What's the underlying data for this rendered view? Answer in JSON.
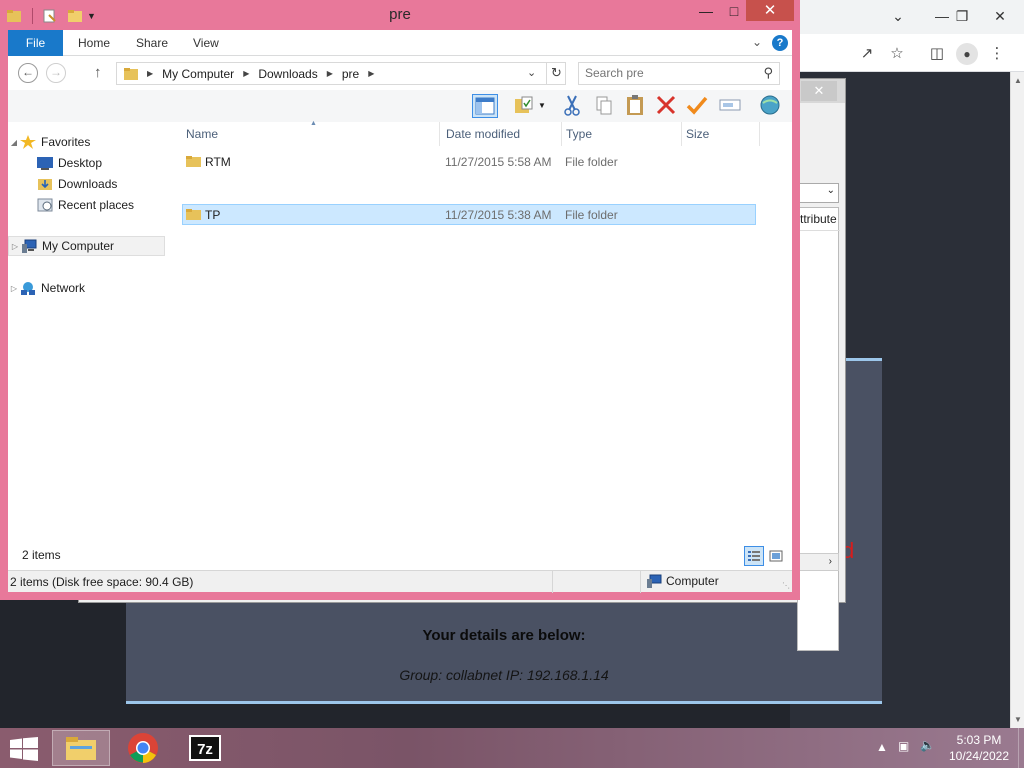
{
  "explorer": {
    "title": "pre",
    "ribbon_tabs": [
      "File",
      "Home",
      "Share",
      "View"
    ],
    "help": "?",
    "breadcrumb": [
      "My Computer",
      "Downloads",
      "pre"
    ],
    "search_placeholder": "Search pre",
    "nav": {
      "favorites": "Favorites",
      "desktop": "Desktop",
      "downloads": "Downloads",
      "recent": "Recent places",
      "my_computer": "My Computer",
      "network": "Network"
    },
    "columns": {
      "name": "Name",
      "date": "Date modified",
      "type": "Type",
      "size": "Size"
    },
    "files": [
      {
        "name": "RTM",
        "date": "11/27/2015 5:58 AM",
        "type": "File folder",
        "size": ""
      },
      {
        "name": "TP",
        "date": "11/27/2015 5:38 AM",
        "type": "File folder",
        "size": ""
      }
    ],
    "items_count": "2 items",
    "status_text": "2 items (Disk free space: 90.4 GB)",
    "status_location": "Computer"
  },
  "background": {
    "properties_column": "ttribute",
    "web_details": "Your details are below:",
    "web_group": "Group: collabnet   IP: 192.168.1.14",
    "web_red_fragment": "d"
  },
  "taskbar": {
    "time": "5:03 PM",
    "date": "10/24/2022"
  },
  "colors": {
    "window_frame": "#e8789a",
    "accent_blue": "#1979ca",
    "selection": "#cce8ff",
    "close_red": "#c7514c"
  }
}
